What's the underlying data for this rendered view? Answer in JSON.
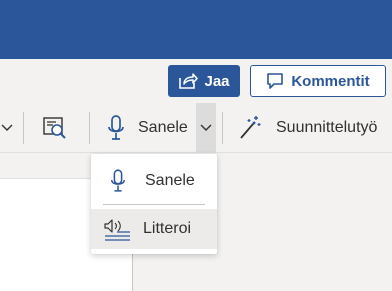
{
  "header": {
    "share_label": "Jaa",
    "comments_label": "Kommentit"
  },
  "ribbon": {
    "dictate_label": "Sanele",
    "designer_label": "Suunnittelutyö"
  },
  "dictate_menu": {
    "items": [
      {
        "label": "Sanele",
        "icon": "microphone-icon"
      },
      {
        "label": "Litteroi",
        "icon": "transcribe-icon"
      }
    ]
  },
  "colors": {
    "brand": "#2b579a",
    "ribbon_background": "#f3f2f1",
    "menu_hover": "#edebe9"
  }
}
